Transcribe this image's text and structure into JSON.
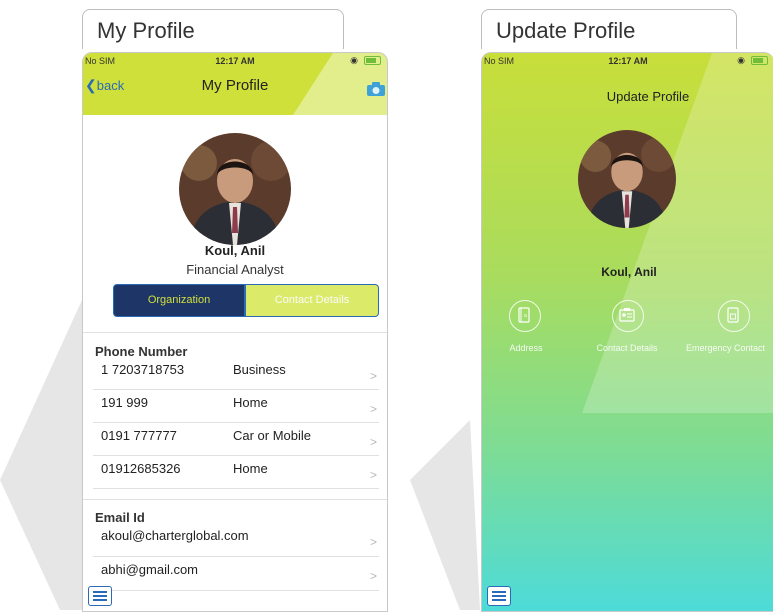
{
  "left": {
    "tab_title": "My Profile",
    "status": {
      "carrier": "No SIM",
      "time": "12:17 AM"
    },
    "nav": {
      "back_label": "back",
      "title": "My Profile"
    },
    "profile": {
      "name": "Koul, Anil",
      "role": "Financial Analyst"
    },
    "segments": {
      "organization": "Organization",
      "contact_details": "Contact Details"
    },
    "phone_section": {
      "heading": "Phone Number",
      "rows": [
        {
          "number": "1 7203718753",
          "type": "Business"
        },
        {
          "number": "191 999",
          "type": "Home"
        },
        {
          "number": "0191 777777",
          "type": "Car or Mobile"
        },
        {
          "number": "01912685326",
          "type": "Home"
        }
      ]
    },
    "email_section": {
      "heading": "Email Id",
      "rows": [
        {
          "email": "akoul@charterglobal.com"
        },
        {
          "email": "abhi@gmail.com"
        }
      ]
    }
  },
  "right": {
    "tab_title": "Update Profile",
    "status": {
      "carrier": "No SIM",
      "time": "12:17 AM"
    },
    "nav": {
      "title": "Update Profile"
    },
    "profile": {
      "name": "Koul, Anil"
    },
    "options": [
      {
        "label": "Address",
        "icon": "address-book-icon"
      },
      {
        "label": "Contact Details",
        "icon": "id-card-icon"
      },
      {
        "label": "Emergency Contact",
        "icon": "contact-card-icon"
      }
    ]
  },
  "colors": {
    "lime": "#cfe03a",
    "navy": "#1e3567",
    "accent_blue": "#2a6ab8",
    "gradient_top": "#c8de3a",
    "gradient_bottom": "#4ddbd9"
  }
}
